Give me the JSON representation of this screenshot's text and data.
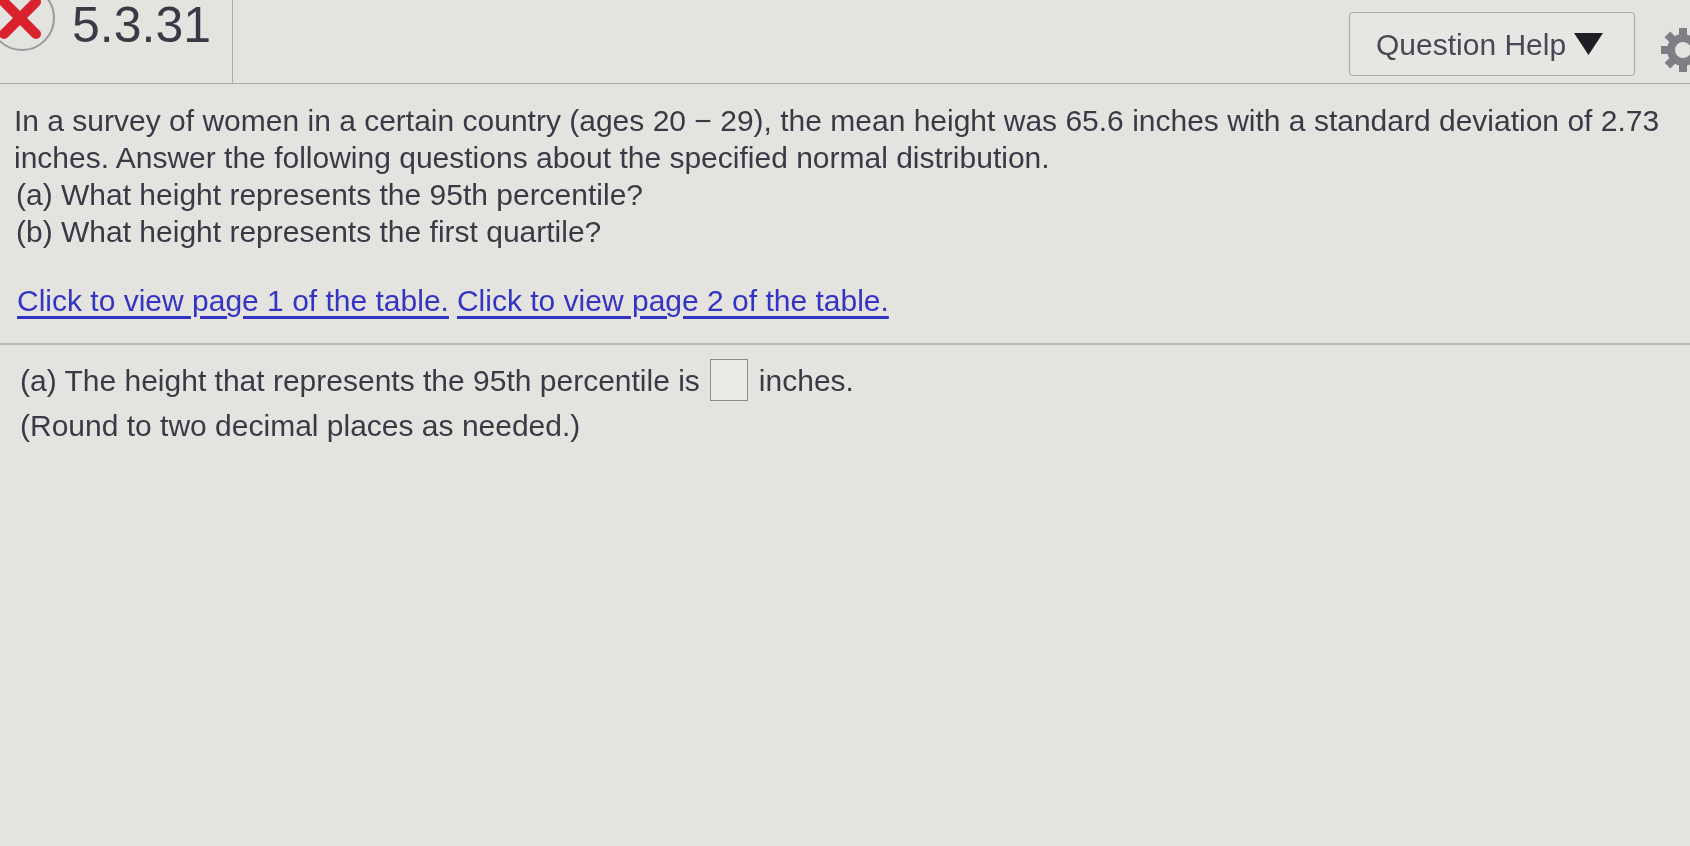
{
  "header": {
    "correct": false,
    "question_number": "5.3.31",
    "help_button": "Question Help"
  },
  "question": {
    "intro": "In a survey of women in a certain country (ages 20 − 29), the mean height was 65.6 inches with a standard deviation of 2.73 inches. Answer the following questions about the specified normal distribution.",
    "parts": [
      "(a) What height represents the 95th percentile?",
      "(b) What height represents the first quartile?"
    ]
  },
  "table_links": [
    "Click to view page 1 of the table.",
    "Click to view page 2 of the table."
  ],
  "answer": {
    "prompt": "(a) The height that represents the 95th percentile is",
    "unit": "inches.",
    "note": "(Round to two decimal places as needed.)"
  }
}
